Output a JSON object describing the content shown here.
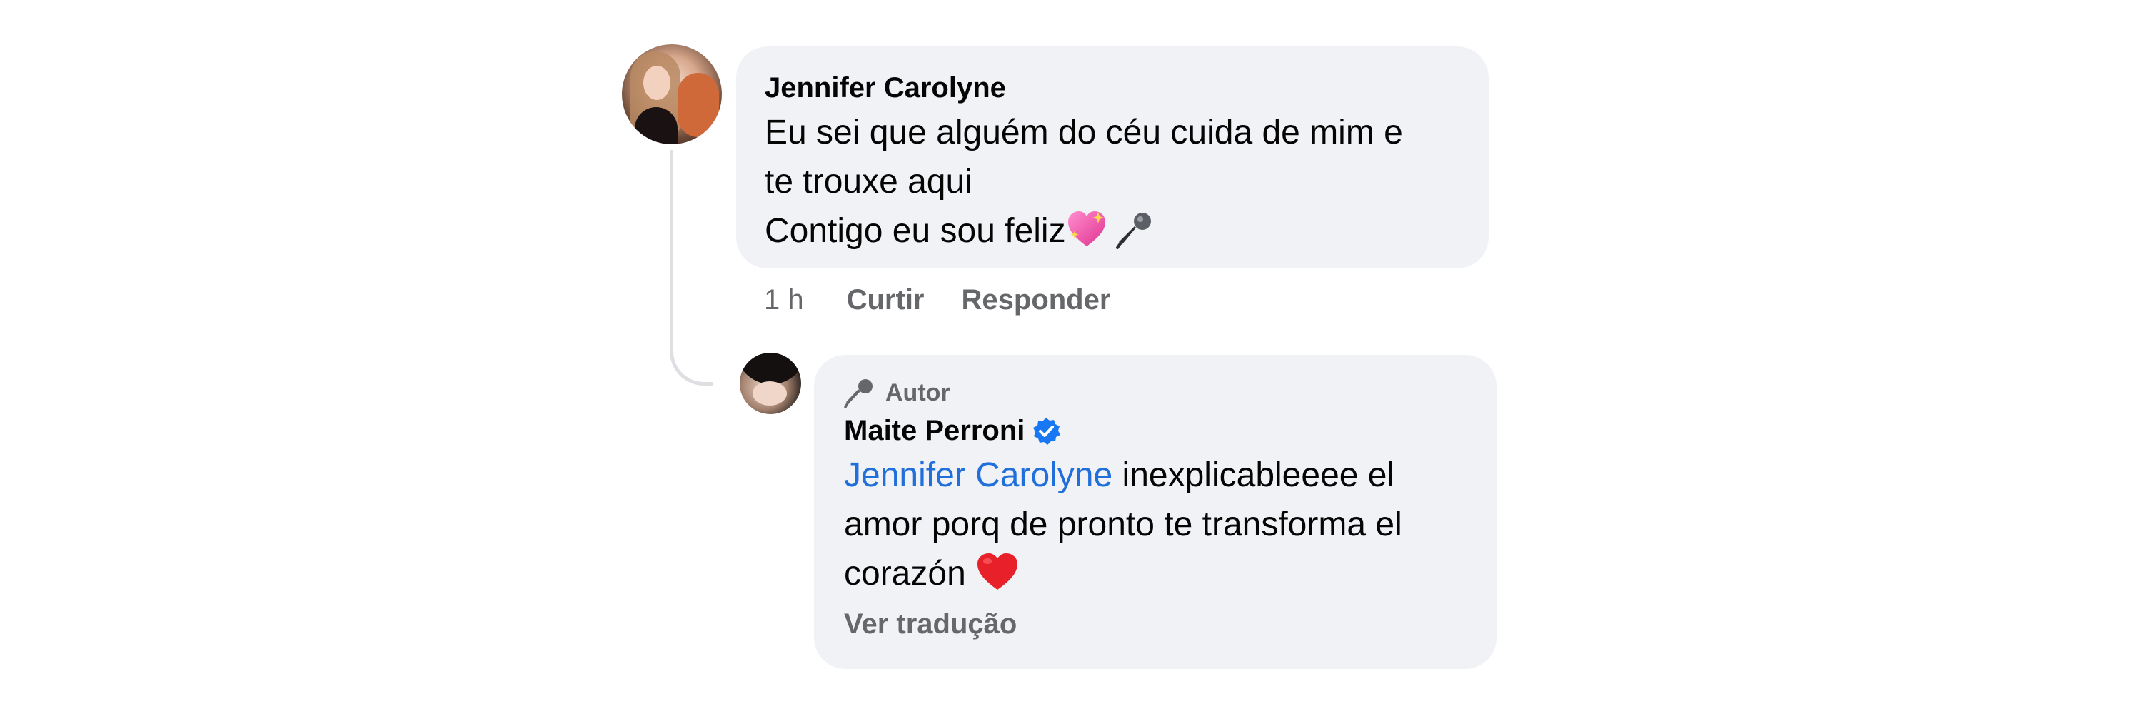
{
  "comments": [
    {
      "author": "Jennifer Carolyne",
      "lines": [
        "Eu sei que alguém do céu cuida de mim e",
        "te trouxe aqui",
        "Contigo eu sou feliz"
      ],
      "emojis": [
        "sparkling-heart",
        "microphone"
      ],
      "timestamp": "1 h",
      "actions": {
        "like": "Curtir",
        "reply": "Responder"
      }
    },
    {
      "badge": "Autor",
      "author": "Maite Perroni",
      "verified": true,
      "mention": "Jennifer Carolyne",
      "text_after_mention": " inexplicableeee el",
      "lines": [
        "amor porq de pronto te transforma el",
        "corazón"
      ],
      "emojis": [
        "red-heart"
      ],
      "see_translation": "Ver tradução"
    }
  ],
  "colors": {
    "bubble": "#f0f2f5",
    "mention": "#216fdb",
    "secondary_text": "#65676b",
    "verified": "#1877f2",
    "thread_line": "#dddfe3"
  }
}
